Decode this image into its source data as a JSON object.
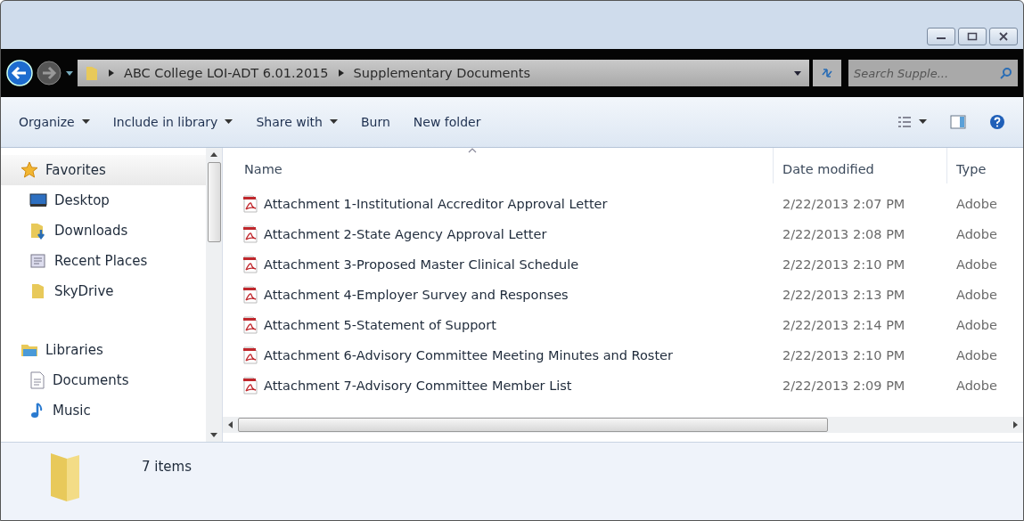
{
  "address": {
    "crumbs": [
      "ABC College LOI-ADT 6.01.2015",
      "Supplementary Documents"
    ]
  },
  "search": {
    "placeholder": "Search Supple..."
  },
  "toolbar": [
    {
      "label": "Organize",
      "dropdown": true
    },
    {
      "label": "Include in library",
      "dropdown": true
    },
    {
      "label": "Share with",
      "dropdown": true
    },
    {
      "label": "Burn",
      "dropdown": false
    },
    {
      "label": "New folder",
      "dropdown": false
    }
  ],
  "navigation": [
    {
      "label": "Favorites",
      "children": [
        {
          "label": "Desktop"
        },
        {
          "label": "Downloads"
        },
        {
          "label": "Recent Places"
        },
        {
          "label": "SkyDrive"
        }
      ]
    },
    {
      "label": "Libraries",
      "children": [
        {
          "label": "Documents"
        },
        {
          "label": "Music"
        }
      ]
    }
  ],
  "table": {
    "columns": [
      "Name",
      "Date modified",
      "Type"
    ],
    "rows": [
      {
        "name": "Attachment 1-Institutional Accreditor Approval Letter",
        "date": "2/22/2013 2:07 PM",
        "type": "Adobe"
      },
      {
        "name": "Attachment 2-State Agency Approval Letter",
        "date": "2/22/2013 2:08 PM",
        "type": "Adobe"
      },
      {
        "name": "Attachment 3-Proposed Master Clinical Schedule",
        "date": "2/22/2013 2:10 PM",
        "type": "Adobe"
      },
      {
        "name": "Attachment 4-Employer Survey and Responses",
        "date": "2/22/2013 2:13 PM",
        "type": "Adobe"
      },
      {
        "name": "Attachment 5-Statement of Support",
        "date": "2/22/2013 2:14 PM",
        "type": "Adobe"
      },
      {
        "name": "Attachment 6-Advisory Committee Meeting Minutes and Roster",
        "date": "2/22/2013 2:10 PM",
        "type": "Adobe"
      },
      {
        "name": "Attachment 7-Advisory Committee Member List",
        "date": "2/22/2013 2:09 PM",
        "type": "Adobe"
      }
    ]
  },
  "status_bar": {
    "count": "7 items"
  }
}
